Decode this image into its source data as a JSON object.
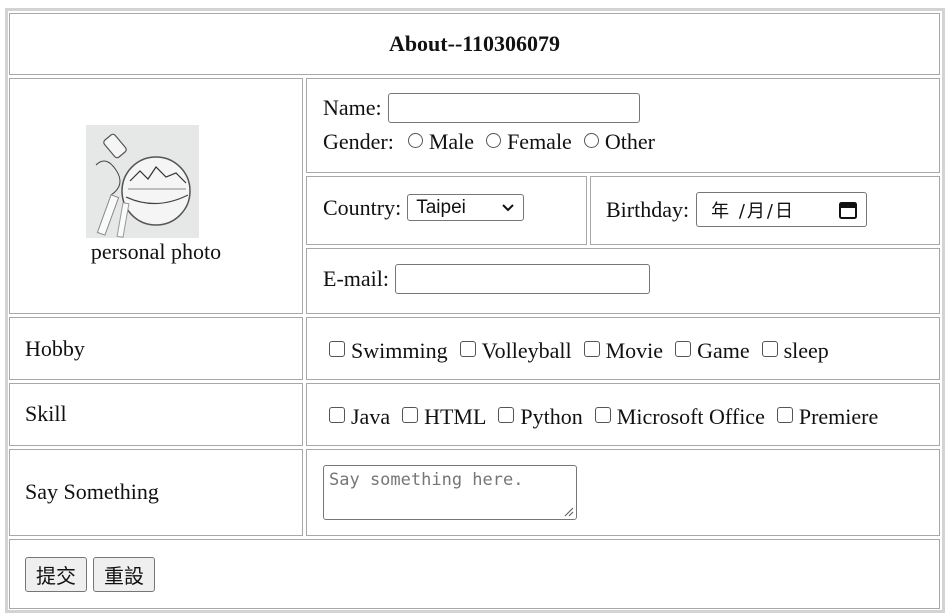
{
  "header": {
    "title": "About--110306079"
  },
  "photo": {
    "caption": "personal photo",
    "icon": "bottle-sketch-photo"
  },
  "name": {
    "label": "Name:",
    "value": ""
  },
  "gender": {
    "label": "Gender:",
    "options": [
      "Male",
      "Female",
      "Other"
    ]
  },
  "country": {
    "label": "Country:",
    "selected": "Taipei"
  },
  "birthday": {
    "label": "Birthday:",
    "placeholder": "年 /月/日"
  },
  "email": {
    "label": "E-mail:",
    "value": ""
  },
  "hobby": {
    "label": "Hobby",
    "options": [
      "Swimming",
      "Volleyball",
      "Movie",
      "Game",
      "sleep"
    ]
  },
  "skill": {
    "label": "Skill",
    "options": [
      "Java",
      "HTML",
      "Python",
      "Microsoft Office",
      "Premiere"
    ]
  },
  "say": {
    "label": "Say Something",
    "placeholder": "Say something here."
  },
  "buttons": {
    "submit": "提交",
    "reset": "重設"
  }
}
